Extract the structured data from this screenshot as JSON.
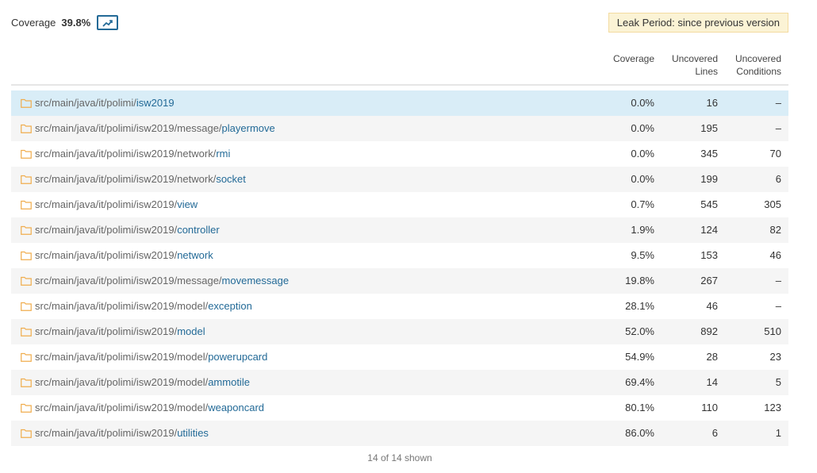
{
  "header": {
    "coverage_label": "Coverage",
    "coverage_value": "39.8%",
    "trend_icon": "trend-chart-icon",
    "leak_period": "Leak Period: since previous version"
  },
  "columns": {
    "coverage": "Coverage",
    "uncovered_lines_1": "Uncovered",
    "uncovered_lines_2": "Lines",
    "uncovered_conditions_1": "Uncovered",
    "uncovered_conditions_2": "Conditions"
  },
  "rows": [
    {
      "prefix": "src/main/java/it/polimi/",
      "leaf": "isw2019",
      "coverage": "0.0%",
      "lines": "16",
      "conditions": "–"
    },
    {
      "prefix": "src/main/java/it/polimi/isw2019/message/",
      "leaf": "playermove",
      "coverage": "0.0%",
      "lines": "195",
      "conditions": "–"
    },
    {
      "prefix": "src/main/java/it/polimi/isw2019/network/",
      "leaf": "rmi",
      "coverage": "0.0%",
      "lines": "345",
      "conditions": "70"
    },
    {
      "prefix": "src/main/java/it/polimi/isw2019/network/",
      "leaf": "socket",
      "coverage": "0.0%",
      "lines": "199",
      "conditions": "6"
    },
    {
      "prefix": "src/main/java/it/polimi/isw2019/",
      "leaf": "view",
      "coverage": "0.7%",
      "lines": "545",
      "conditions": "305"
    },
    {
      "prefix": "src/main/java/it/polimi/isw2019/",
      "leaf": "controller",
      "coverage": "1.9%",
      "lines": "124",
      "conditions": "82"
    },
    {
      "prefix": "src/main/java/it/polimi/isw2019/",
      "leaf": "network",
      "coverage": "9.5%",
      "lines": "153",
      "conditions": "46"
    },
    {
      "prefix": "src/main/java/it/polimi/isw2019/message/",
      "leaf": "movemessage",
      "coverage": "19.8%",
      "lines": "267",
      "conditions": "–"
    },
    {
      "prefix": "src/main/java/it/polimi/isw2019/model/",
      "leaf": "exception",
      "coverage": "28.1%",
      "lines": "46",
      "conditions": "–"
    },
    {
      "prefix": "src/main/java/it/polimi/isw2019/",
      "leaf": "model",
      "coverage": "52.0%",
      "lines": "892",
      "conditions": "510"
    },
    {
      "prefix": "src/main/java/it/polimi/isw2019/model/",
      "leaf": "powerupcard",
      "coverage": "54.9%",
      "lines": "28",
      "conditions": "23"
    },
    {
      "prefix": "src/main/java/it/polimi/isw2019/model/",
      "leaf": "ammotile",
      "coverage": "69.4%",
      "lines": "14",
      "conditions": "5"
    },
    {
      "prefix": "src/main/java/it/polimi/isw2019/model/",
      "leaf": "weaponcard",
      "coverage": "80.1%",
      "lines": "110",
      "conditions": "123"
    },
    {
      "prefix": "src/main/java/it/polimi/isw2019/",
      "leaf": "utilities",
      "coverage": "86.0%",
      "lines": "6",
      "conditions": "1"
    }
  ],
  "footer": {
    "shown": "14 of 14 shown"
  },
  "colors": {
    "selected_row": "#d9edf7",
    "link": "#236a97",
    "folder": "#f0ad4e",
    "leak_bg": "#fbf3d5"
  }
}
